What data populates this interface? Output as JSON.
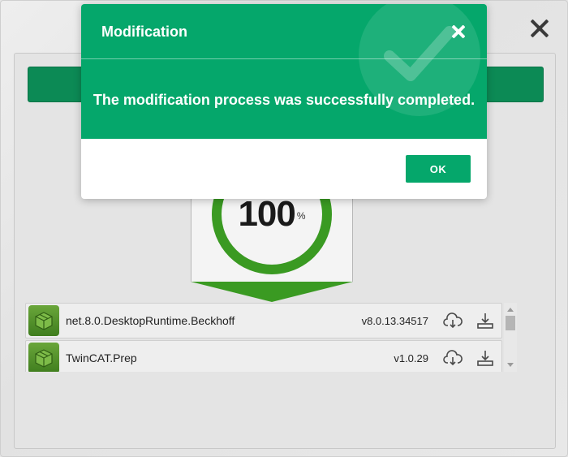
{
  "dialog": {
    "title": "Modification",
    "message": "The modification process was successfully completed.",
    "ok_label": "OK"
  },
  "progress": {
    "value": "100",
    "unit": "%",
    "fraction": 1.0
  },
  "packages": [
    {
      "name": "net.8.0.DesktopRuntime.Beckhoff",
      "version": "v8.0.13.34517"
    },
    {
      "name": "TwinCAT.Prep",
      "version": "v1.0.29"
    }
  ],
  "colors": {
    "dialog_green": "#05a76b",
    "header_green": "#0c8a55",
    "progress_green": "#3a9a22"
  },
  "icons": {
    "window_close": "close-icon",
    "dialog_close": "close-icon",
    "package": "package-icon",
    "cloud_download": "cloud-download-icon",
    "download": "download-icon",
    "watermark": "checkmark-icon"
  }
}
